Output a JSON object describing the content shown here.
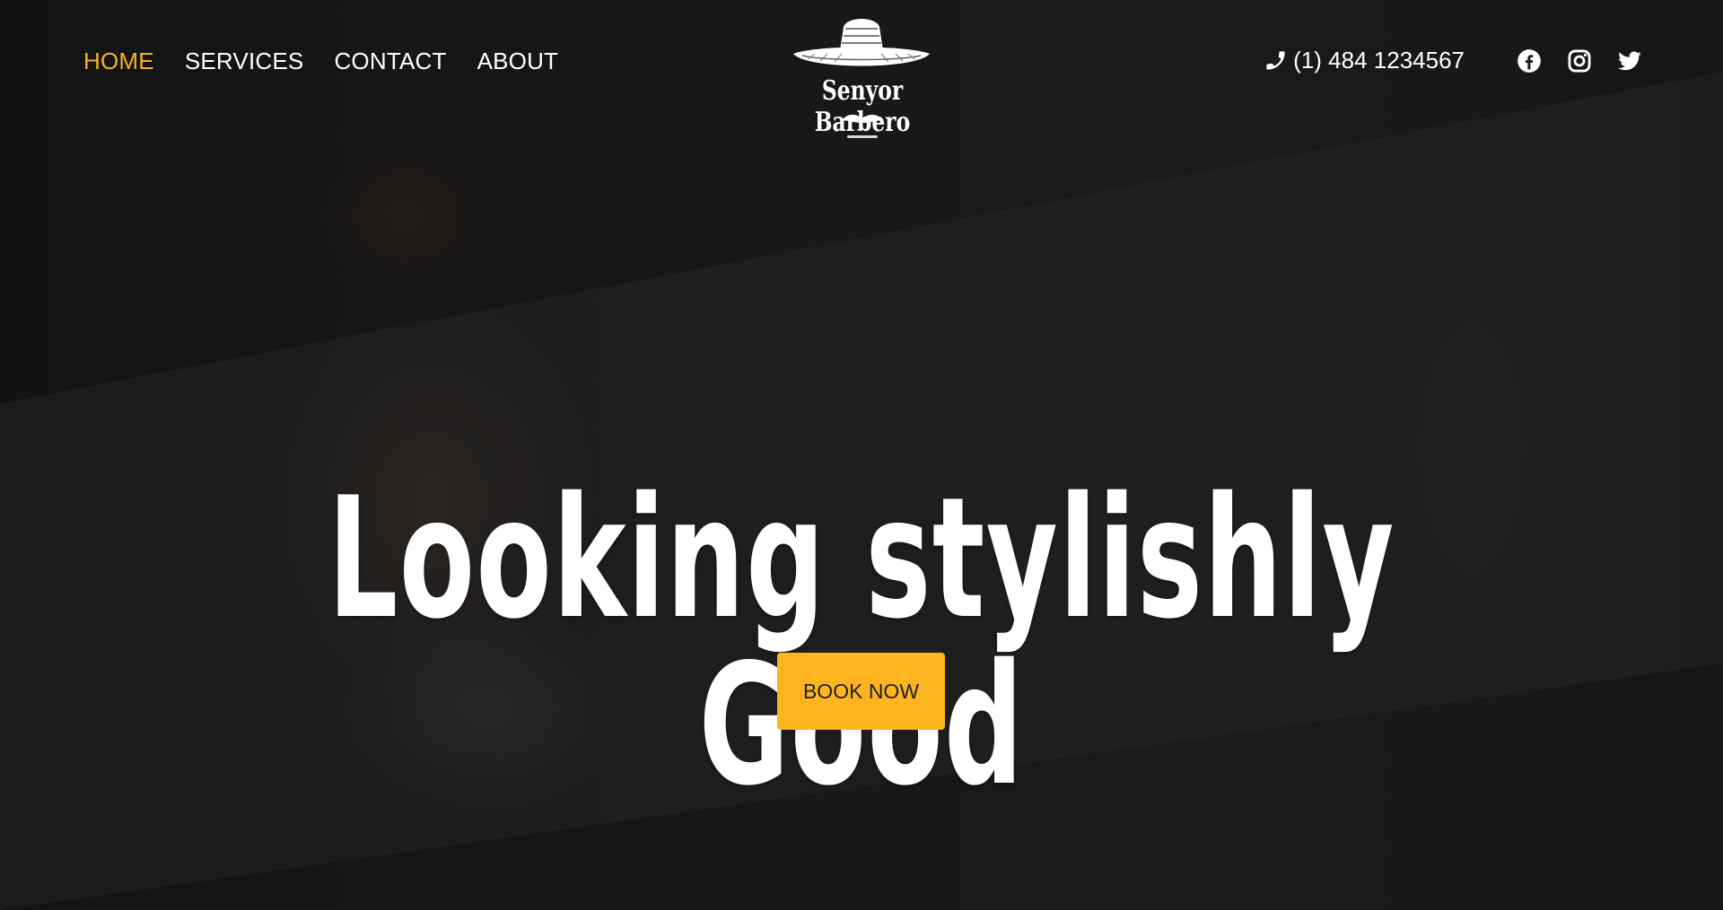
{
  "nav": {
    "items": [
      {
        "label": "HOME",
        "active": true
      },
      {
        "label": "SERVICES",
        "active": false
      },
      {
        "label": "CONTACT",
        "active": false
      },
      {
        "label": "ABOUT",
        "active": false
      }
    ]
  },
  "brand": {
    "name": "Senyor Barbero",
    "logo_icons": [
      "sombrero-icon",
      "mustache-icon"
    ]
  },
  "contact": {
    "phone": "(1) 484 1234567",
    "phone_icon": "phone-icon",
    "social": [
      "facebook-icon",
      "instagram-icon",
      "twitter-icon"
    ]
  },
  "hero": {
    "headline": "Looking stylishly Good",
    "cta_label": "BOOK NOW"
  },
  "colors": {
    "accent": "#fdb41e",
    "active_nav": "#f5b21d",
    "text": "#ffffff",
    "background": "#1a1a1b"
  }
}
